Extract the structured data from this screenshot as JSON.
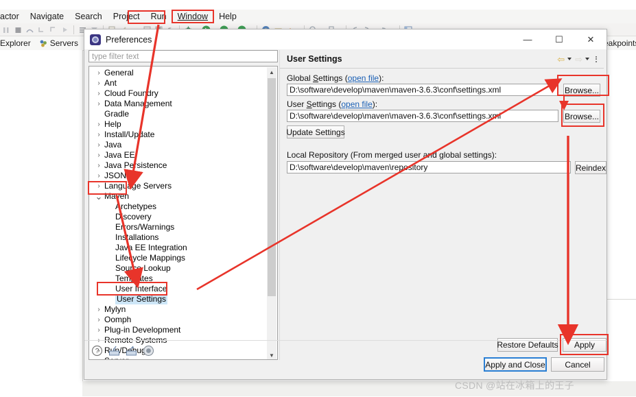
{
  "ide": {
    "menubar": [
      {
        "label": "actor",
        "truncated": true,
        "highlight": false
      },
      {
        "label": "Navigate",
        "highlight": false
      },
      {
        "label": "Search",
        "highlight": false
      },
      {
        "label": "Project",
        "highlight": false
      },
      {
        "label": "Run",
        "highlight": false
      },
      {
        "label": "Window",
        "highlight": true
      },
      {
        "label": "Help",
        "highlight": false
      }
    ],
    "view_tabs": [
      {
        "label": "Explorer",
        "icon": "package-explorer-icon"
      },
      {
        "label": "Servers",
        "icon": "servers-icon"
      }
    ],
    "right_view_tab": {
      "label": "eakpoints",
      "full": "Breakpoints",
      "icon": "breakpoints-icon"
    }
  },
  "dialog": {
    "title": "Preferences",
    "icon": "preferences-icon",
    "window_controls": {
      "minimize": "—",
      "maximize": "☐",
      "close": "✕"
    },
    "filter": {
      "placeholder": "type filter text",
      "value": ""
    },
    "tree": [
      {
        "label": "General",
        "level": 1,
        "expandable": true,
        "expanded": false,
        "selected": false
      },
      {
        "label": "Ant",
        "level": 1,
        "expandable": true,
        "expanded": false,
        "selected": false
      },
      {
        "label": "Cloud Foundry",
        "level": 1,
        "expandable": true,
        "expanded": false,
        "selected": false
      },
      {
        "label": "Data Management",
        "level": 1,
        "expandable": true,
        "expanded": false,
        "selected": false
      },
      {
        "label": "Gradle",
        "level": 1,
        "expandable": false,
        "expanded": false,
        "selected": false
      },
      {
        "label": "Help",
        "level": 1,
        "expandable": true,
        "expanded": false,
        "selected": false
      },
      {
        "label": "Install/Update",
        "level": 1,
        "expandable": true,
        "expanded": false,
        "selected": false
      },
      {
        "label": "Java",
        "level": 1,
        "expandable": true,
        "expanded": false,
        "selected": false
      },
      {
        "label": "Java EE",
        "level": 1,
        "expandable": true,
        "expanded": false,
        "selected": false
      },
      {
        "label": "Java Persistence",
        "level": 1,
        "expandable": true,
        "expanded": false,
        "selected": false
      },
      {
        "label": "JSON",
        "level": 1,
        "expandable": true,
        "expanded": false,
        "selected": false
      },
      {
        "label": "Language Servers",
        "level": 1,
        "expandable": true,
        "expanded": false,
        "selected": false
      },
      {
        "label": "Maven",
        "level": 1,
        "expandable": true,
        "expanded": true,
        "selected": false
      },
      {
        "label": "Archetypes",
        "level": 2,
        "expandable": false,
        "expanded": false,
        "selected": false
      },
      {
        "label": "Discovery",
        "level": 2,
        "expandable": false,
        "expanded": false,
        "selected": false
      },
      {
        "label": "Errors/Warnings",
        "level": 2,
        "expandable": false,
        "expanded": false,
        "selected": false
      },
      {
        "label": "Installations",
        "level": 2,
        "expandable": false,
        "expanded": false,
        "selected": false
      },
      {
        "label": "Java EE Integration",
        "level": 2,
        "expandable": false,
        "expanded": false,
        "selected": false
      },
      {
        "label": "Lifecycle Mappings",
        "level": 2,
        "expandable": false,
        "expanded": false,
        "selected": false
      },
      {
        "label": "Source Lookup",
        "level": 2,
        "expandable": false,
        "expanded": false,
        "selected": false
      },
      {
        "label": "Templates",
        "level": 2,
        "expandable": false,
        "expanded": false,
        "selected": false
      },
      {
        "label": "User Interface",
        "level": 2,
        "expandable": false,
        "expanded": false,
        "selected": false
      },
      {
        "label": "User Settings",
        "level": 2,
        "expandable": false,
        "expanded": false,
        "selected": true
      },
      {
        "label": "Mylyn",
        "level": 1,
        "expandable": true,
        "expanded": false,
        "selected": false
      },
      {
        "label": "Oomph",
        "level": 1,
        "expandable": true,
        "expanded": false,
        "selected": false
      },
      {
        "label": "Plug-in Development",
        "level": 1,
        "expandable": true,
        "expanded": false,
        "selected": false
      },
      {
        "label": "Remote Systems",
        "level": 1,
        "expandable": true,
        "expanded": false,
        "selected": false
      },
      {
        "label": "Run/Debug",
        "level": 1,
        "expandable": true,
        "expanded": false,
        "selected": false
      },
      {
        "label": "Server",
        "level": 1,
        "expandable": true,
        "expanded": false,
        "selected": false
      }
    ],
    "pane": {
      "title": "User Settings",
      "global_settings": {
        "label_prefix": "Global ",
        "label_underlined": "S",
        "label_rest": "ettings (",
        "link": "open file",
        "label_suffix": "):",
        "value": "D:\\software\\develop\\maven\\maven-3.6.3\\conf\\settings.xml",
        "browse_label": "Browse..."
      },
      "user_settings": {
        "label_prefix": "User ",
        "label_underlined": "S",
        "label_rest": "ettings (",
        "link": "open file",
        "label_suffix": "):",
        "value": "D:\\software\\develop\\maven\\maven-3.6.3\\conf\\settings.xml",
        "browse_label": "Browse..."
      },
      "update_settings_label": "Update Settings",
      "local_repository": {
        "label": "Local Repository (From merged user and global settings):",
        "value": "D:\\software\\develop\\maven\\repository",
        "reindex_label": "Reindex"
      }
    },
    "footer": {
      "icons": [
        "help-icon",
        "import-preferences-icon",
        "export-preferences-icon",
        "record-icon"
      ],
      "restore_defaults_label": "Restore Defaults",
      "apply_label": "Apply",
      "apply_and_close_label": "Apply and Close",
      "cancel_label": "Cancel"
    }
  },
  "annotations": {
    "accent_color": "#e8342a",
    "watermark": "CSDN @站在冰箱上的王子"
  }
}
